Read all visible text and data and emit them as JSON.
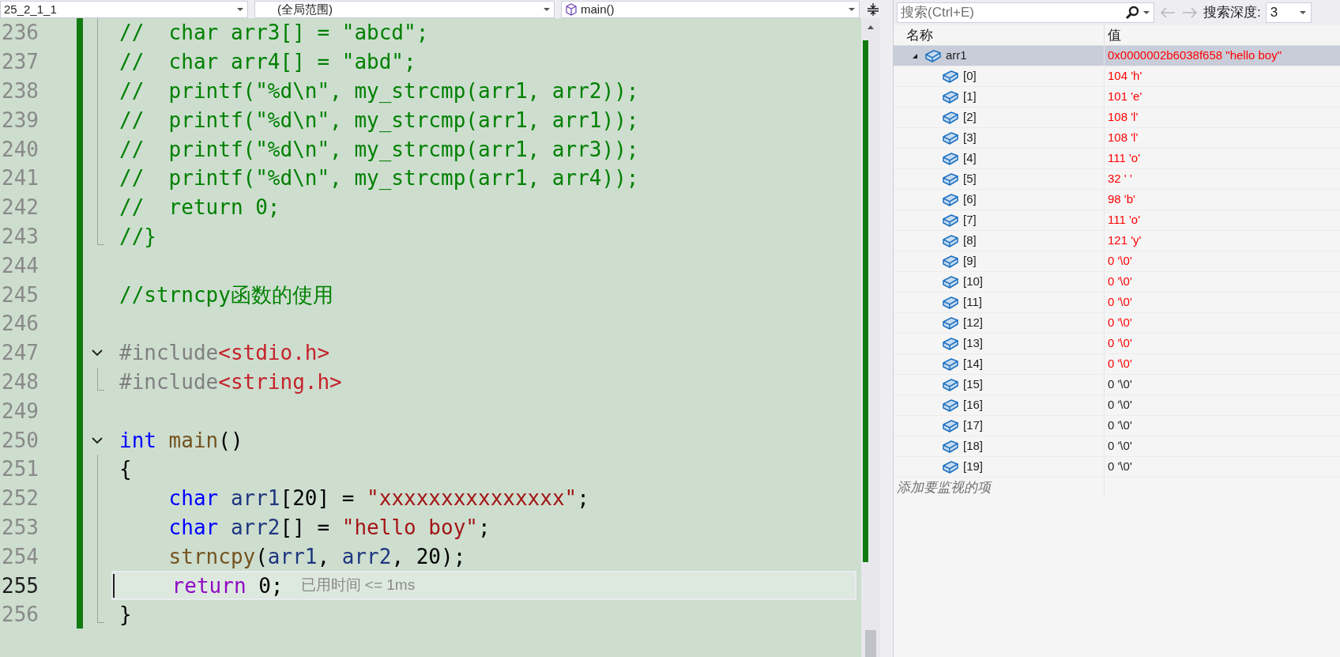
{
  "toolbar": {
    "project": "25_2_1_1",
    "scope": "(全局范围)",
    "function": "main()"
  },
  "editor": {
    "lines": [
      {
        "number": "236",
        "kind": "inside",
        "current": false,
        "tokens": [
          {
            "text": "//  char arr3[] = \"abcd\";",
            "kind": "comment"
          }
        ]
      },
      {
        "number": "237",
        "kind": "inside",
        "current": false,
        "tokens": [
          {
            "text": "//  char arr4[] = \"abd\";",
            "kind": "comment"
          }
        ]
      },
      {
        "number": "238",
        "kind": "inside",
        "current": false,
        "tokens": [
          {
            "text": "//  printf(\"%d\\n\", my_strcmp(arr1, arr2));",
            "kind": "comment"
          }
        ]
      },
      {
        "number": "239",
        "kind": "inside",
        "current": false,
        "tokens": [
          {
            "text": "//  printf(\"%d\\n\", my_strcmp(arr1, arr1));",
            "kind": "comment"
          }
        ]
      },
      {
        "number": "240",
        "kind": "inside",
        "current": false,
        "tokens": [
          {
            "text": "//  printf(\"%d\\n\", my_strcmp(arr1, arr3));",
            "kind": "comment"
          }
        ]
      },
      {
        "number": "241",
        "kind": "inside",
        "current": false,
        "tokens": [
          {
            "text": "//  printf(\"%d\\n\", my_strcmp(arr1, arr4));",
            "kind": "comment"
          }
        ]
      },
      {
        "number": "242",
        "kind": "inside",
        "current": false,
        "tokens": [
          {
            "text": "//  return 0;",
            "kind": "comment"
          }
        ]
      },
      {
        "number": "243",
        "kind": "end",
        "current": false,
        "tokens": [
          {
            "text": "//}",
            "kind": "comment"
          }
        ]
      },
      {
        "number": "244",
        "kind": "plain",
        "current": false
      },
      {
        "number": "245",
        "kind": "plain",
        "current": false,
        "tokens": [
          {
            "text": "//strncpy函数的使用",
            "kind": "comment"
          }
        ]
      },
      {
        "number": "246",
        "kind": "plain",
        "current": false
      },
      {
        "number": "247",
        "kind": "start",
        "current": false,
        "tokens": [
          {
            "text": "#include",
            "kind": "preprocessor"
          },
          {
            "text": "<stdio.h>",
            "kind": "header"
          }
        ]
      },
      {
        "number": "248",
        "kind": "end",
        "current": false,
        "tokens": [
          {
            "text": "#include",
            "kind": "preprocessor"
          },
          {
            "text": "<string.h>",
            "kind": "header"
          }
        ]
      },
      {
        "number": "249",
        "kind": "plain",
        "current": false
      },
      {
        "number": "250",
        "kind": "start",
        "current": false,
        "tokens": [
          {
            "text": "int",
            "kind": "keyword"
          },
          {
            "text": " main",
            "kind": "function"
          },
          {
            "text": "()",
            "kind": "plain"
          }
        ]
      },
      {
        "number": "251",
        "kind": "inside",
        "current": false,
        "tokens": [
          {
            "text": "{",
            "kind": "plain"
          }
        ]
      },
      {
        "number": "252",
        "kind": "inside",
        "current": false,
        "tokens": [
          {
            "text": "    char",
            "kind": "keyword"
          },
          {
            "text": " arr1",
            "kind": "variable"
          },
          {
            "text": "[20] = ",
            "kind": "plain"
          },
          {
            "text": "\"xxxxxxxxxxxxxxx\"",
            "kind": "string"
          },
          {
            "text": ";",
            "kind": "plain"
          }
        ]
      },
      {
        "number": "253",
        "kind": "inside",
        "current": false,
        "tokens": [
          {
            "text": "    char",
            "kind": "keyword"
          },
          {
            "text": " arr2",
            "kind": "variable"
          },
          {
            "text": "[] = ",
            "kind": "plain"
          },
          {
            "text": "\"hello boy\"",
            "kind": "string"
          },
          {
            "text": ";",
            "kind": "plain"
          }
        ]
      },
      {
        "number": "254",
        "kind": "inside",
        "current": false,
        "tokens": [
          {
            "text": "    strncpy",
            "kind": "function"
          },
          {
            "text": "(",
            "kind": "plain"
          },
          {
            "text": "arr1",
            "kind": "variable"
          },
          {
            "text": ", ",
            "kind": "plain"
          },
          {
            "text": "arr2",
            "kind": "variable"
          },
          {
            "text": ", 20);",
            "kind": "plain"
          }
        ]
      },
      {
        "number": "255",
        "kind": "inside",
        "current": true,
        "hint": "已用时间 <= 1ms",
        "tokens": [
          {
            "text": "    return",
            "kind": "control"
          },
          {
            "text": " 0;",
            "kind": "plain"
          }
        ]
      },
      {
        "number": "256",
        "kind": "end",
        "current": false,
        "tokens": [
          {
            "text": "}",
            "kind": "plain"
          }
        ]
      }
    ]
  },
  "watch": {
    "search": {
      "placeholder": "搜索(Ctrl+E)"
    },
    "back": {
      "disabled": true
    },
    "forward": {
      "disabled": true
    },
    "depth_label": "搜索深度:",
    "depth": "3",
    "columns": [
      "名称",
      "值"
    ],
    "items": [
      {
        "name": "arr1",
        "value": "0x0000002b6038f658 \"hello boy\"",
        "changed": true,
        "selected": true,
        "expanded": true,
        "children": [
          {
            "name": "[0]",
            "value": "104 'h'",
            "changed": true,
            "selected": false
          },
          {
            "name": "[1]",
            "value": "101 'e'",
            "changed": true,
            "selected": false
          },
          {
            "name": "[2]",
            "value": "108 'l'",
            "changed": true,
            "selected": false
          },
          {
            "name": "[3]",
            "value": "108 'l'",
            "changed": true,
            "selected": false
          },
          {
            "name": "[4]",
            "value": "111 'o'",
            "changed": true,
            "selected": false
          },
          {
            "name": "[5]",
            "value": "32 ' '",
            "changed": true,
            "selected": false
          },
          {
            "name": "[6]",
            "value": "98 'b'",
            "changed": true,
            "selected": false
          },
          {
            "name": "[7]",
            "value": "111 'o'",
            "changed": true,
            "selected": false
          },
          {
            "name": "[8]",
            "value": "121 'y'",
            "changed": true,
            "selected": false
          },
          {
            "name": "[9]",
            "value": "0 '\\0'",
            "changed": true,
            "selected": false
          },
          {
            "name": "[10]",
            "value": "0 '\\0'",
            "changed": true,
            "selected": false
          },
          {
            "name": "[11]",
            "value": "0 '\\0'",
            "changed": true,
            "selected": false
          },
          {
            "name": "[12]",
            "value": "0 '\\0'",
            "changed": true,
            "selected": false
          },
          {
            "name": "[13]",
            "value": "0 '\\0'",
            "changed": true,
            "selected": false
          },
          {
            "name": "[14]",
            "value": "0 '\\0'",
            "changed": true,
            "selected": false
          },
          {
            "name": "[15]",
            "value": "0 '\\0'",
            "changed": false,
            "selected": false
          },
          {
            "name": "[16]",
            "value": "0 '\\0'",
            "changed": false,
            "selected": false
          },
          {
            "name": "[17]",
            "value": "0 '\\0'",
            "changed": false,
            "selected": false
          },
          {
            "name": "[18]",
            "value": "0 '\\0'",
            "changed": false,
            "selected": false
          },
          {
            "name": "[19]",
            "value": "0 '\\0'",
            "changed": false,
            "selected": false
          }
        ]
      }
    ],
    "add_placeholder": "添加要监视的项"
  }
}
